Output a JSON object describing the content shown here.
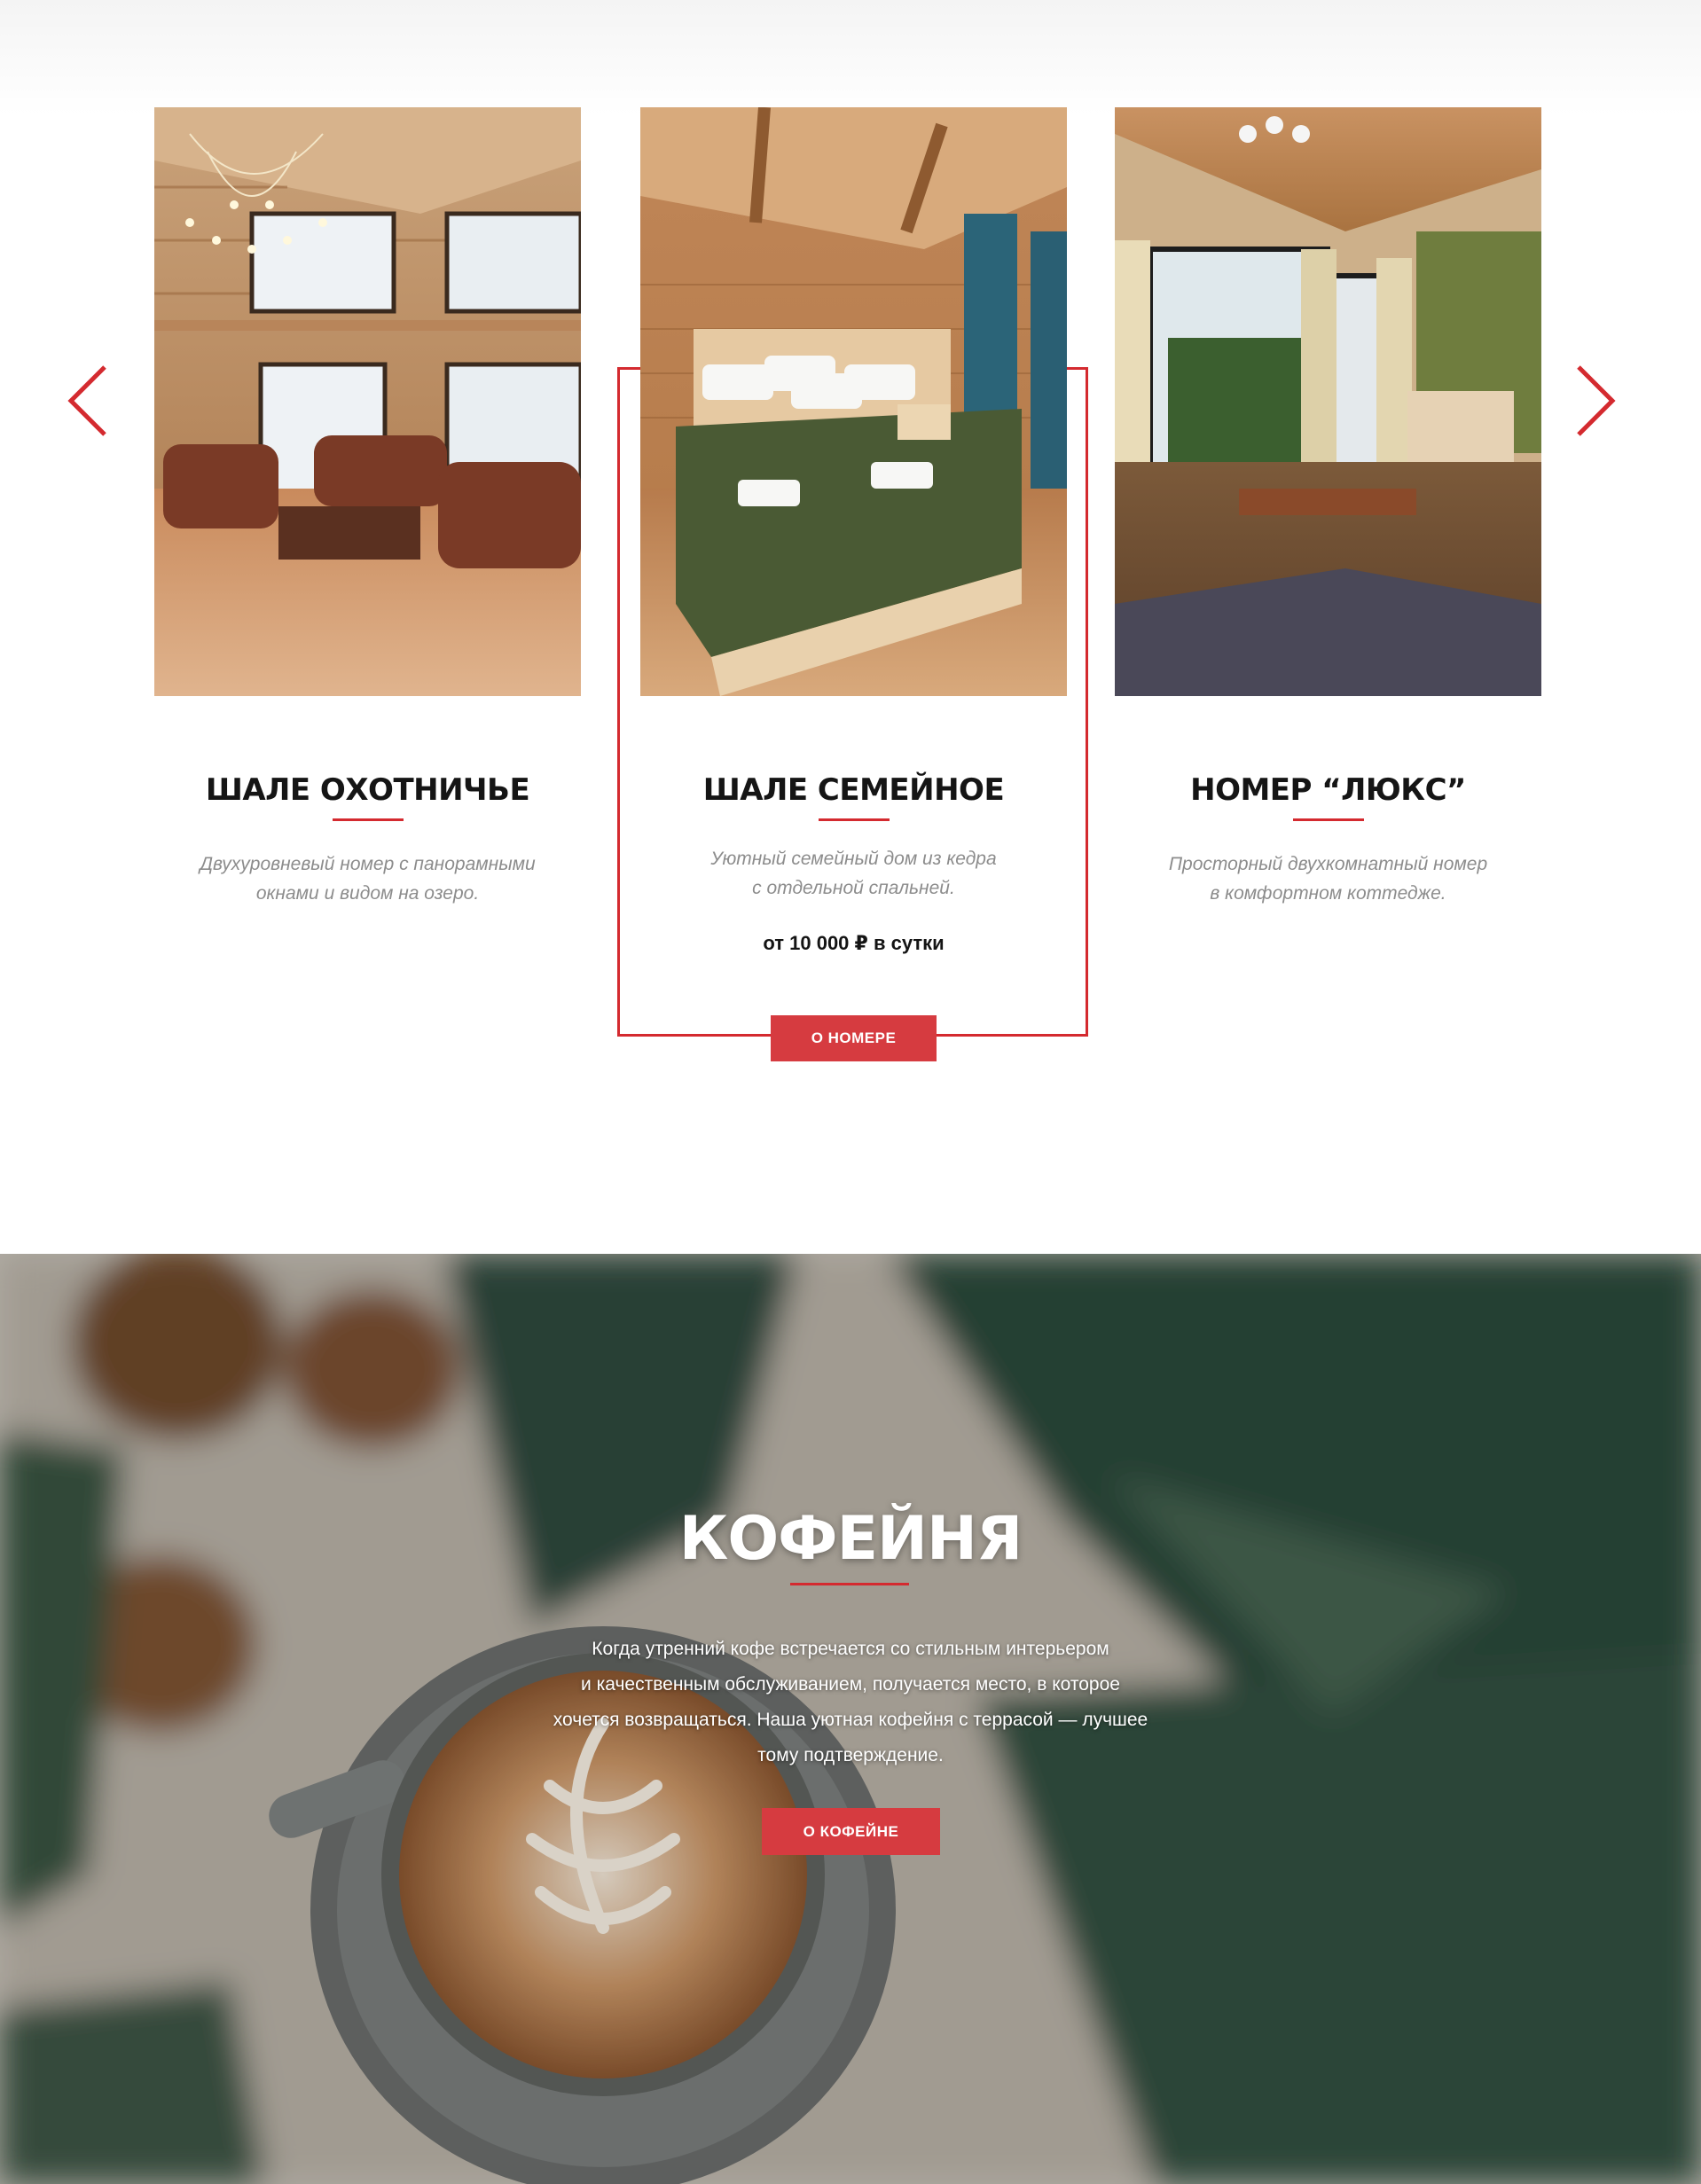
{
  "slider": {
    "rooms": [
      {
        "title": "ШАЛЕ ОХОТНИЧЬЕ",
        "description": [
          "Двухуровневый номер с панорамными",
          "окнами и видом на озеро."
        ]
      },
      {
        "title": "ШАЛЕ СЕМЕЙНОЕ",
        "description": [
          "Уютный семейный дом из кедра",
          "с отдельной спальней."
        ],
        "price": "от 10 000 ₽ в сутки",
        "button_label": "О НОМЕРЕ"
      },
      {
        "title": "НОМЕР “ЛЮКС”",
        "description": [
          "Просторный двухкомнатный номер",
          "в комфортном коттедже."
        ]
      }
    ],
    "prev_icon": "chevron-left-icon",
    "next_icon": "chevron-right-icon"
  },
  "cafe": {
    "title": "КОФЕЙНЯ",
    "text": [
      "Когда утренний кофе встречается со стильным интерьером",
      "и качественным обслуживанием, получается место, в которое",
      "хочется возвращаться. Наша уютная кофейня с террасой — лучшее",
      "тому подтверждение."
    ],
    "button_label": "О КОФЕЙНЕ"
  },
  "colors": {
    "accent": "#d42a2f",
    "button": "#d63b40",
    "title_text": "#151515",
    "muted_text": "#8c8c8c"
  }
}
